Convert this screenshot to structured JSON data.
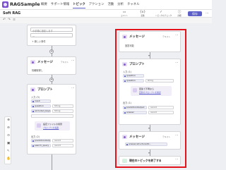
{
  "app": {
    "title": "RAGSample"
  },
  "tabs": [
    "概要",
    "サポート情報",
    "トピック",
    "アクション",
    "活動",
    "分析",
    "チャネル"
  ],
  "active_tab": "トピック",
  "subbar": {
    "topic_name": "Soft RAG",
    "tools": [
      {
        "icon": "comment-icon",
        "label": "コメント"
      },
      {
        "icon": "variable-icon",
        "label": "変数"
      },
      {
        "icon": "test-icon",
        "label": "トピックのチェック"
      },
      {
        "icon": "details-icon",
        "label": "詳細"
      }
    ],
    "save": "保存"
  },
  "left_flow": {
    "top_card": {
      "placeholder": "の手順に設定します",
      "link": "新しい条件"
    },
    "message": {
      "title": "メッセージ",
      "tag": "テキスト",
      "text": "情報取得し"
    },
    "prompt": {
      "title": "プロンプト",
      "input_label": "入力 (3)",
      "inputs": [
        {
          "name": "input",
          "type": "String"
        },
        {
          "name": "question",
          "type": "String"
        },
        {
          "name": "excluded_keywords",
          "type": "String"
        }
      ],
      "callout_text": "設定ファイルの用意",
      "callout_link": "プロンプトを編集",
      "output_label": "出力 (2)",
      "outputs": [
        {
          "name": "predictionOutput",
          "type": "record"
        },
        {
          "name": "search_query",
          "type": "record"
        }
      ]
    }
  },
  "right_flow": {
    "message1": {
      "title": "メッセージ",
      "tag": "テキスト",
      "text": "回答可能"
    },
    "prompt": {
      "title": "プロンプト",
      "input_label": "入力 (1)",
      "inputs": [
        {
          "name": "question",
          "type": "String"
        },
        {
          "name": "question",
          "type": "string"
        }
      ],
      "callout_text": "回答で不明なら",
      "callout_link": "回答のプロンプトを確認",
      "output_label": "出力 (1)",
      "outputs": [
        {
          "name": "predictionOutput",
          "type": "record"
        },
        {
          "name": "answer",
          "type": "record"
        }
      ]
    },
    "message2": {
      "title": "メッセージ",
      "tag": "テキスト",
      "text": "answer.structuredO..."
    },
    "end": {
      "title": "現在のトピックを終了する"
    }
  }
}
